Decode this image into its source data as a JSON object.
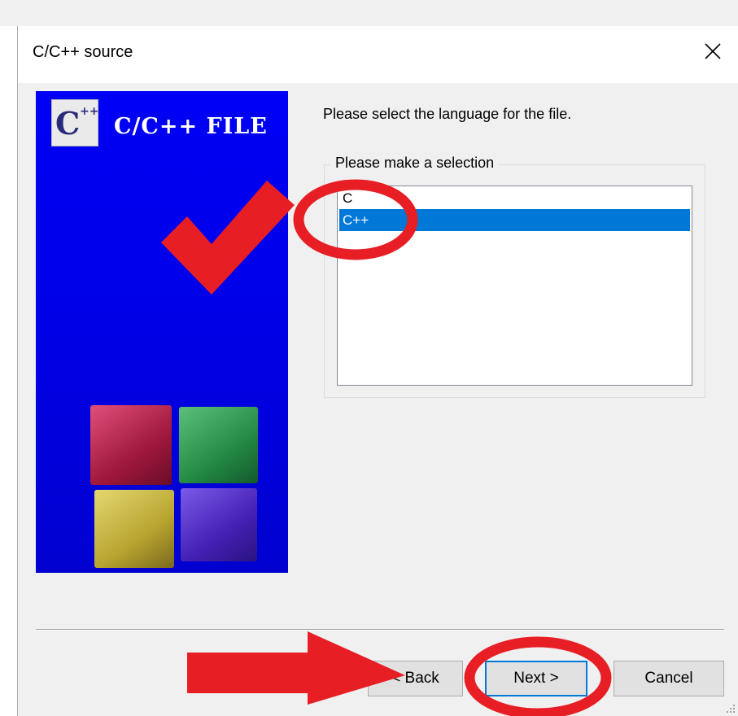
{
  "dialog": {
    "title": "C/C++ source",
    "close_glyph": "✕"
  },
  "banner": {
    "logo_letter": "C",
    "logo_plus": "++",
    "title": "C/C++ FILE",
    "cube_colors": [
      "#b0204a",
      "#2c9a4a",
      "#c9b43a",
      "#4a20c0"
    ]
  },
  "main": {
    "prompt": "Please select the language for the file.",
    "group_label": "Please make a selection",
    "languages": [
      {
        "label": "C",
        "selected": false
      },
      {
        "label": "C++",
        "selected": true
      }
    ]
  },
  "buttons": {
    "back": "< Back",
    "next": "Next >",
    "cancel": "Cancel"
  },
  "annotations": {
    "color": "#e81e25",
    "checkmark": "check-icon",
    "arrow": "right-arrow-icon"
  },
  "colors": {
    "selection": "#0078d7",
    "banner": "#0000e8"
  }
}
